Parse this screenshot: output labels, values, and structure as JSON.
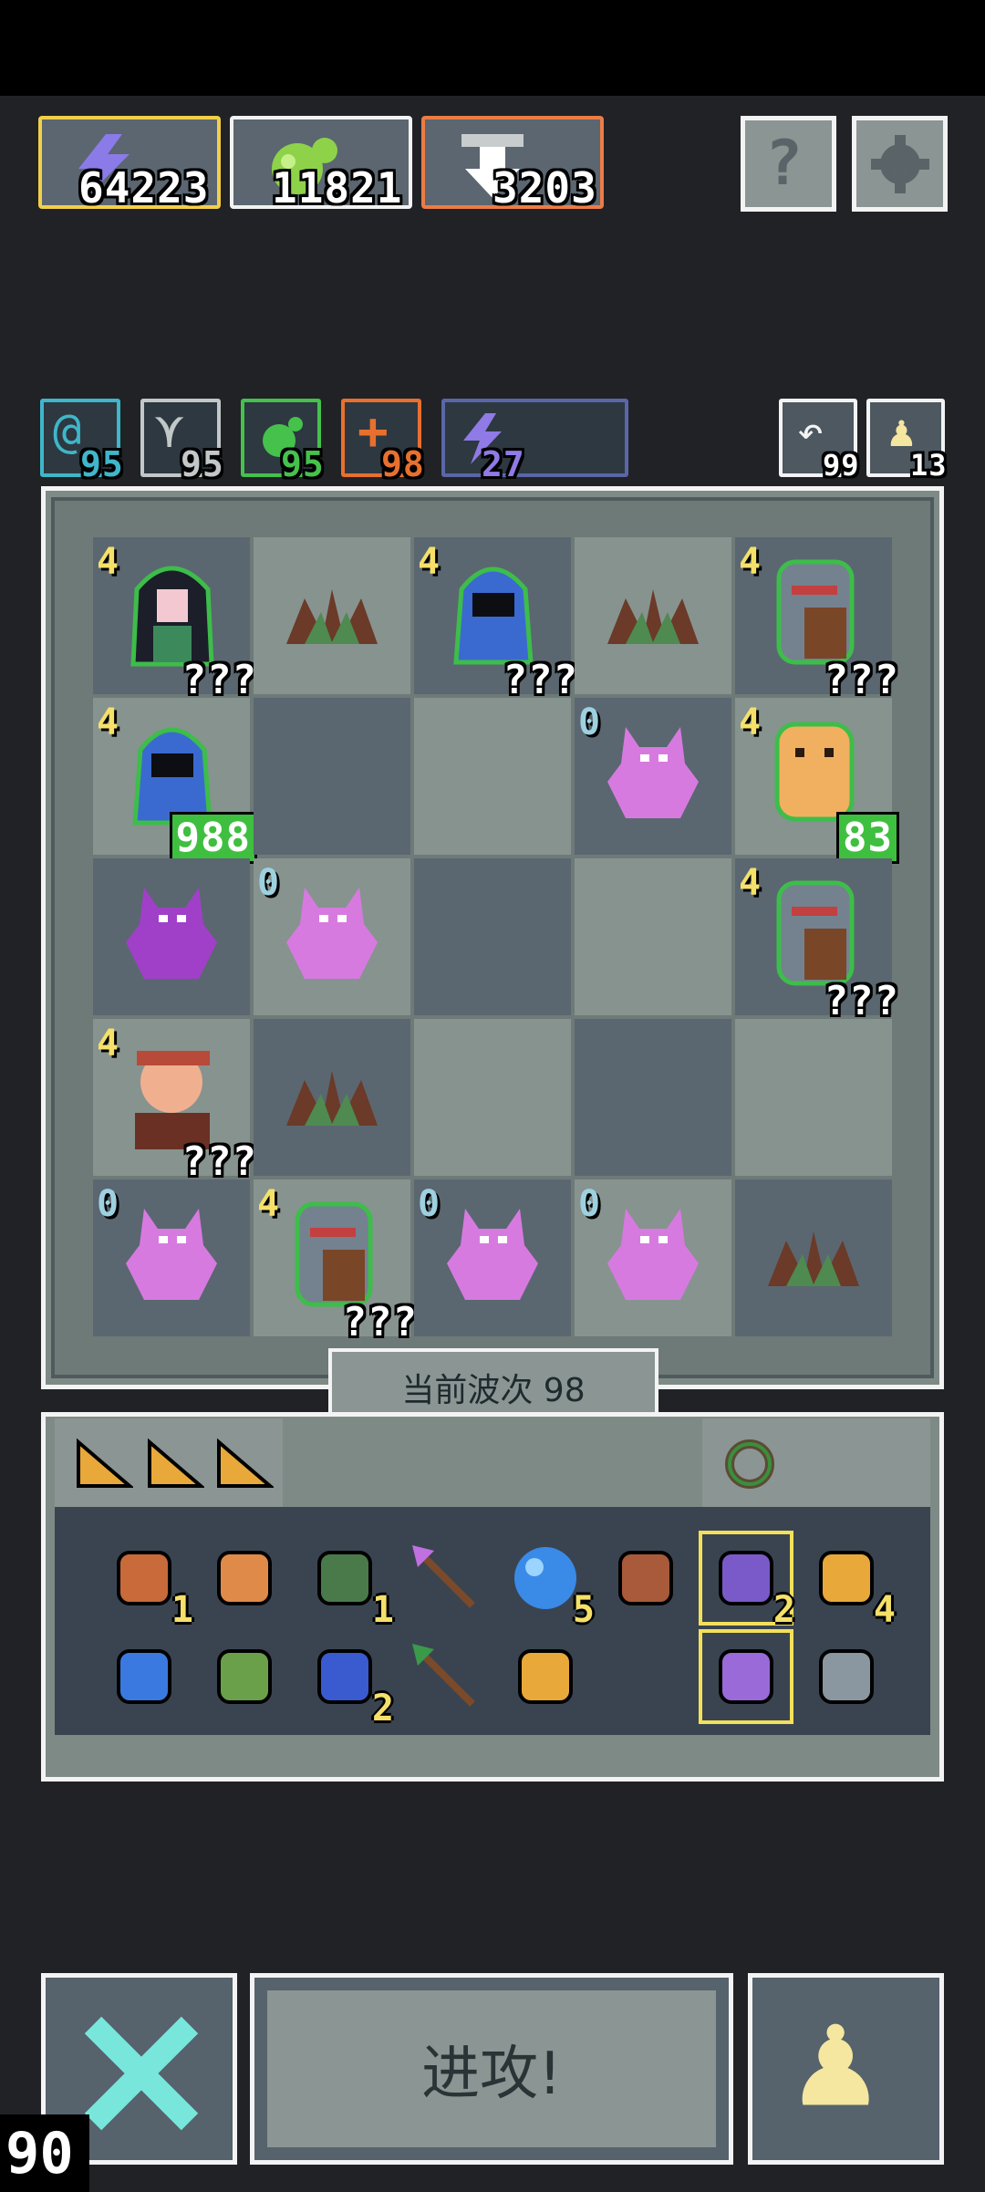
{
  "resources": [
    {
      "name": "energy-icon",
      "value": "64223",
      "border": "#f3cf4a"
    },
    {
      "name": "green-orb-icon",
      "value": "11821",
      "border": "#f3f3f3"
    },
    {
      "name": "down-arrow-icon",
      "value": "3203",
      "border": "#ec7c45"
    }
  ],
  "top_buttons": {
    "help": "?",
    "settings": "gear"
  },
  "stats": [
    {
      "name": "swirl-icon",
      "value": "95",
      "color": "#3fb6c9"
    },
    {
      "name": "bird-icon",
      "value": "95",
      "color": "#c2c8c8"
    },
    {
      "name": "green-drop-icon",
      "value": "95",
      "color": "#45c14c"
    },
    {
      "name": "orange-plus-icon",
      "value": "98",
      "color": "#e8702e"
    },
    {
      "name": "purple-bolt-icon",
      "value": "27",
      "color": "#8f7ae6"
    }
  ],
  "counters": {
    "refresh": "99",
    "pawn": "13"
  },
  "board": [
    [
      {
        "t": "hero-girl",
        "lvl": "4",
        "cnt": "???",
        "bg": "d"
      },
      {
        "t": "plant",
        "bg": "l"
      },
      {
        "t": "hood",
        "lvl": "4",
        "cnt": "???",
        "bg": "d"
      },
      {
        "t": "plant",
        "bg": "l"
      },
      {
        "t": "knight",
        "lvl": "4",
        "cnt": "???",
        "bg": "d"
      }
    ],
    [
      {
        "t": "hood",
        "lvl": "4",
        "cnt": "988",
        "green": true,
        "bg": "l"
      },
      {
        "t": "",
        "bg": "d"
      },
      {
        "t": "",
        "bg": "l"
      },
      {
        "t": "demon",
        "lvl": "0",
        "bg": "d"
      },
      {
        "t": "golem",
        "lvl": "4",
        "cnt": "83",
        "green": true,
        "bg": "l"
      }
    ],
    [
      {
        "t": "demon-dark",
        "bg": "d"
      },
      {
        "t": "demon",
        "lvl": "0",
        "bg": "l"
      },
      {
        "t": "",
        "bg": "d"
      },
      {
        "t": "",
        "bg": "l"
      },
      {
        "t": "knight",
        "lvl": "4",
        "cnt": "???",
        "bg": "d"
      }
    ],
    [
      {
        "t": "warrior",
        "lvl": "4",
        "cnt": "???",
        "bg": "l"
      },
      {
        "t": "plant",
        "bg": "d"
      },
      {
        "t": "",
        "bg": "l"
      },
      {
        "t": "",
        "bg": "d"
      },
      {
        "t": "",
        "bg": "l"
      }
    ],
    [
      {
        "t": "demon",
        "lvl": "0",
        "bg": "d"
      },
      {
        "t": "knight",
        "lvl": "4",
        "cnt": "???",
        "bg": "l"
      },
      {
        "t": "demon",
        "lvl": "0",
        "bg": "d"
      },
      {
        "t": "demon",
        "lvl": "0",
        "bg": "l"
      },
      {
        "t": "plant",
        "bg": "d"
      }
    ]
  ],
  "wave_label": "当前波次 98",
  "inventory_row1": [
    {
      "name": "lantern-item",
      "cnt": "1"
    },
    {
      "name": "armor-item",
      "cnt": ""
    },
    {
      "name": "goblin-item",
      "cnt": "1"
    },
    {
      "name": "arrow-purple-item",
      "cnt": ""
    },
    {
      "name": "blue-orb-item",
      "cnt": "5"
    },
    {
      "name": "feather-item",
      "cnt": ""
    },
    {
      "name": "potion-item",
      "cnt": "2"
    },
    {
      "name": "ring-item",
      "cnt": "4"
    }
  ],
  "inventory_row2": [
    {
      "name": "wind-item",
      "cnt": ""
    },
    {
      "name": "chest-monster-item",
      "cnt": ""
    },
    {
      "name": "hourglass-item",
      "cnt": "2"
    },
    {
      "name": "arrow-green-item",
      "cnt": ""
    },
    {
      "name": "key-item",
      "cnt": ""
    },
    {
      "name": "",
      "cnt": ""
    },
    {
      "name": "staff-item",
      "cnt": ""
    },
    {
      "name": "lever-item",
      "cnt": ""
    }
  ],
  "attack_label": "进攻!",
  "fps": "90"
}
